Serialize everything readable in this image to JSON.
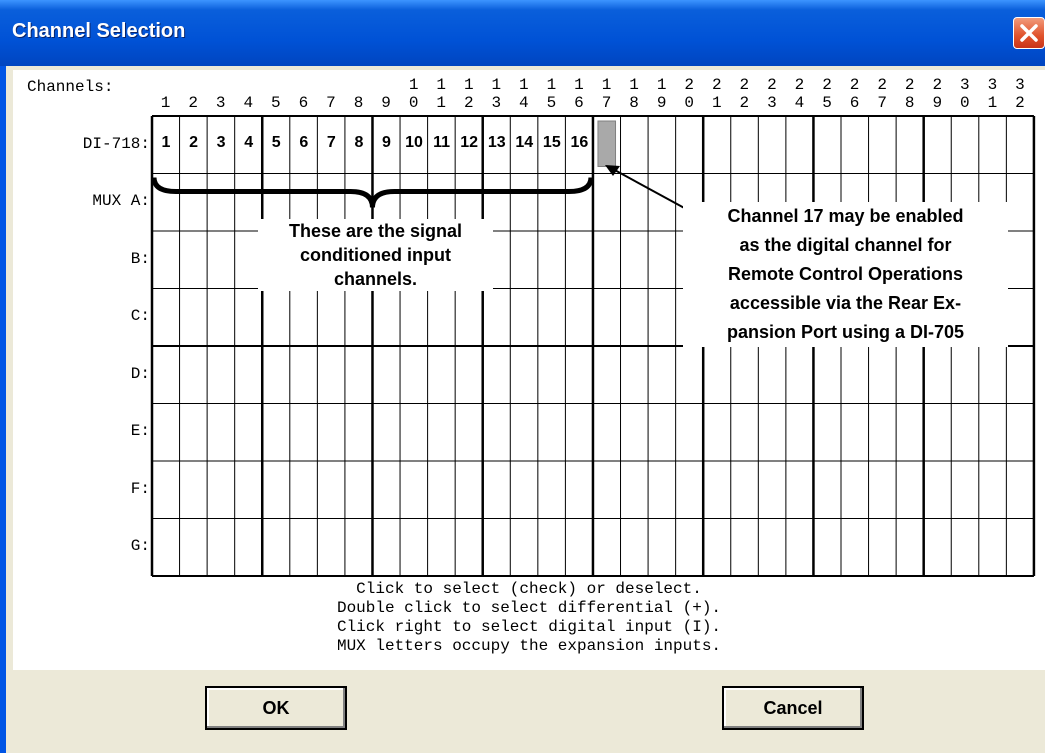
{
  "window": {
    "title": "Channel Selection",
    "close_icon": "close-x-icon"
  },
  "channels_label": "Channels:",
  "channel_numbers": [
    "1",
    "2",
    "3",
    "4",
    "5",
    "6",
    "7",
    "8",
    "9",
    "10",
    "11",
    "12",
    "13",
    "14",
    "15",
    "16",
    "17",
    "18",
    "19",
    "20",
    "21",
    "22",
    "23",
    "24",
    "25",
    "26",
    "27",
    "28",
    "29",
    "30",
    "31",
    "32"
  ],
  "rows": [
    {
      "label": "DI-718:"
    },
    {
      "label": "MUX A:"
    },
    {
      "label": "B:"
    },
    {
      "label": "C:"
    },
    {
      "label": "D:"
    },
    {
      "label": "E:"
    },
    {
      "label": "F:"
    },
    {
      "label": "G:"
    }
  ],
  "selected_cells": [
    "1",
    "2",
    "3",
    "4",
    "5",
    "6",
    "7",
    "8",
    "9",
    "10",
    "11",
    "12",
    "13",
    "14",
    "15",
    "16"
  ],
  "highlighted_channel": "17",
  "annotation_left": {
    "lines": [
      "These are the signal",
      "conditioned input",
      "channels."
    ]
  },
  "annotation_right": {
    "lines": [
      "Channel 17 may be enabled",
      "as the digital channel for",
      "Remote Control Operations",
      "accessible via the Rear Ex-",
      "pansion Port using a DI-705"
    ]
  },
  "instructions": [
    "Click to select (check) or deselect.",
    "Double click to select differential (+).",
    "Click right to select digital input (I).",
    "MUX letters occupy the expansion inputs."
  ],
  "buttons": {
    "ok": "OK",
    "cancel": "Cancel"
  }
}
